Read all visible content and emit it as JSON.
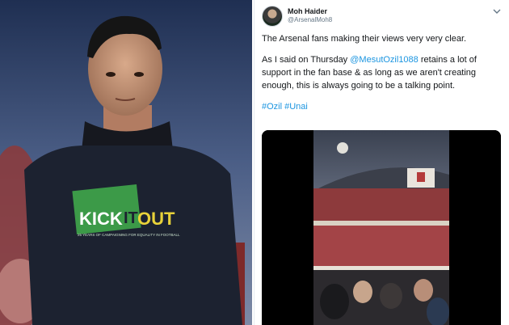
{
  "tweet": {
    "display_name": "Moh Haider",
    "handle": "@ArsenalMoh8",
    "line1": "The Arsenal fans making their views very very clear.",
    "line2_pre": "As I said on Thursday ",
    "mention": "@MesutOzil1088",
    "line2_post": " retains a lot of support in the fan base & as long as we aren't creating enough, this is always going to be a talking point.",
    "hashtag1": "#Ozil",
    "hashtag2": "#Unai"
  },
  "photo": {
    "shirt_logo_kick": "KICK",
    "shirt_logo_it": "IT",
    "shirt_logo_out": "OUT",
    "shirt_tagline": "25 YEARS OF CAMPAIGNING FOR EQUALITY IN FOOTBALL"
  },
  "colors": {
    "link": "#1b95e0",
    "kick_it_out_green": "#3c9a48",
    "shirt": "#1c2230"
  },
  "icons": {
    "menu": "chevron-down-icon"
  }
}
